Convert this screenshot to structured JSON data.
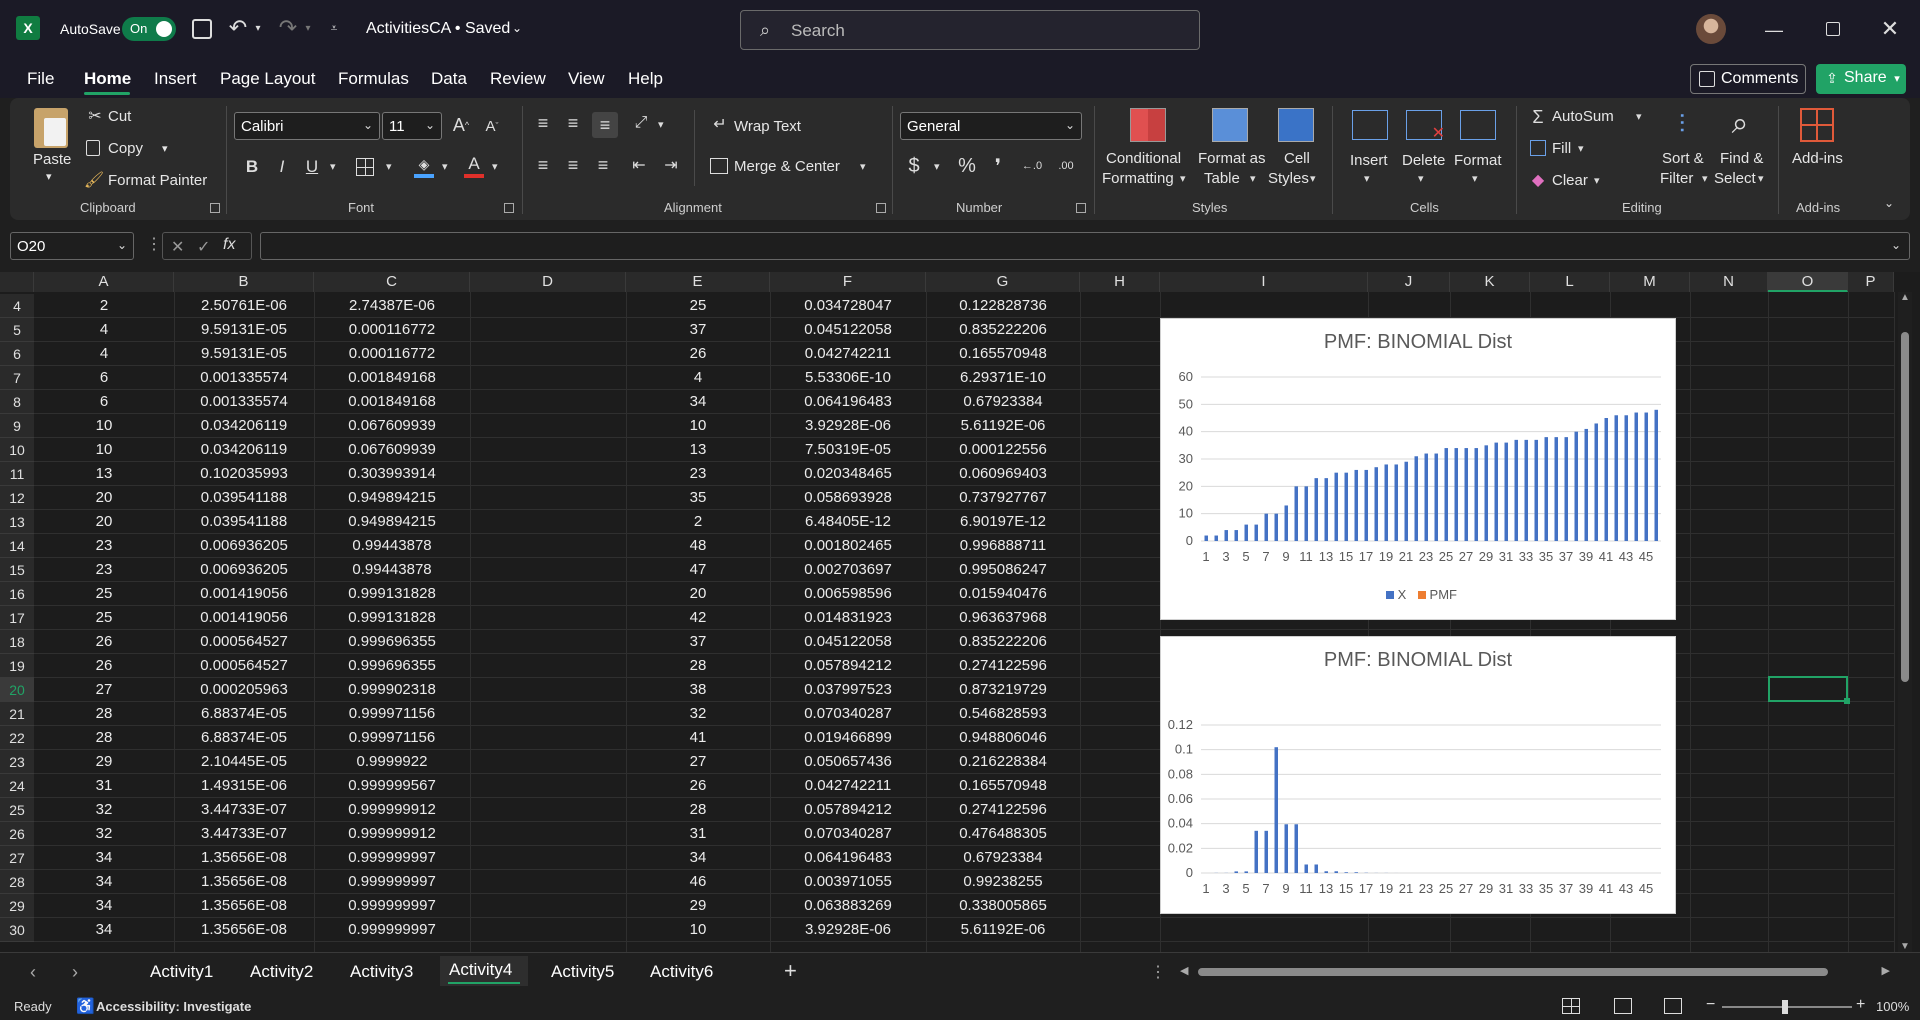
{
  "titlebar": {
    "autosave_label": "AutoSave",
    "autosave_state": "On",
    "file_title": "ActivitiesCA • Saved",
    "search_placeholder": "Search"
  },
  "menu": [
    "File",
    "Home",
    "Insert",
    "Page Layout",
    "Formulas",
    "Data",
    "Review",
    "View",
    "Help"
  ],
  "active_menu": "Home",
  "comments_label": "Comments",
  "share_label": "Share",
  "ribbon": {
    "clipboard": {
      "paste": "Paste",
      "cut": "Cut",
      "copy": "Copy",
      "format_painter": "Format Painter",
      "label": "Clipboard"
    },
    "font": {
      "name": "Calibri",
      "size": "11",
      "label": "Font"
    },
    "alignment": {
      "wrap": "Wrap Text",
      "merge": "Merge & Center",
      "label": "Alignment"
    },
    "number": {
      "format": "General",
      "label": "Number"
    },
    "styles": {
      "conditional": "Conditional",
      "conditional2": "Formatting",
      "format_table": "Format as",
      "format_table2": "Table",
      "cell_styles": "Cell",
      "cell_styles2": "Styles",
      "label": "Styles"
    },
    "cells": {
      "insert": "Insert",
      "delete": "Delete",
      "format": "Format",
      "label": "Cells"
    },
    "editing": {
      "autosum": "AutoSum",
      "fill": "Fill",
      "clear": "Clear",
      "sort": "Sort &",
      "sort2": "Filter",
      "find": "Find &",
      "find2": "Select",
      "label": "Editing"
    },
    "addins": {
      "addins": "Add-ins",
      "label": "Add-ins"
    }
  },
  "namebox": "O20",
  "columns": [
    "A",
    "B",
    "C",
    "D",
    "E",
    "F",
    "G",
    "H",
    "I",
    "J",
    "K",
    "L",
    "M",
    "N",
    "O",
    "P"
  ],
  "rows": [
    {
      "n": "4",
      "a": "2",
      "b": "2.50761E-06",
      "c": "2.74387E-06",
      "e": "25",
      "f": "0.034728047",
      "g": "0.122828736"
    },
    {
      "n": "5",
      "a": "4",
      "b": "9.59131E-05",
      "c": "0.000116772",
      "e": "37",
      "f": "0.045122058",
      "g": "0.835222206"
    },
    {
      "n": "6",
      "a": "4",
      "b": "9.59131E-05",
      "c": "0.000116772",
      "e": "26",
      "f": "0.042742211",
      "g": "0.165570948"
    },
    {
      "n": "7",
      "a": "6",
      "b": "0.001335574",
      "c": "0.001849168",
      "e": "4",
      "f": "5.53306E-10",
      "g": "6.29371E-10"
    },
    {
      "n": "8",
      "a": "6",
      "b": "0.001335574",
      "c": "0.001849168",
      "e": "34",
      "f": "0.064196483",
      "g": "0.67923384"
    },
    {
      "n": "9",
      "a": "10",
      "b": "0.034206119",
      "c": "0.067609939",
      "e": "10",
      "f": "3.92928E-06",
      "g": "5.61192E-06"
    },
    {
      "n": "10",
      "a": "10",
      "b": "0.034206119",
      "c": "0.067609939",
      "e": "13",
      "f": "7.50319E-05",
      "g": "0.000122556"
    },
    {
      "n": "11",
      "a": "13",
      "b": "0.102035993",
      "c": "0.303993914",
      "e": "23",
      "f": "0.020348465",
      "g": "0.060969403"
    },
    {
      "n": "12",
      "a": "20",
      "b": "0.039541188",
      "c": "0.949894215",
      "e": "35",
      "f": "0.058693928",
      "g": "0.737927767"
    },
    {
      "n": "13",
      "a": "20",
      "b": "0.039541188",
      "c": "0.949894215",
      "e": "2",
      "f": "6.48405E-12",
      "g": "6.90197E-12"
    },
    {
      "n": "14",
      "a": "23",
      "b": "0.006936205",
      "c": "0.99443878",
      "e": "48",
      "f": "0.001802465",
      "g": "0.996888711"
    },
    {
      "n": "15",
      "a": "23",
      "b": "0.006936205",
      "c": "0.99443878",
      "e": "47",
      "f": "0.002703697",
      "g": "0.995086247"
    },
    {
      "n": "16",
      "a": "25",
      "b": "0.001419056",
      "c": "0.999131828",
      "e": "20",
      "f": "0.006598596",
      "g": "0.015940476"
    },
    {
      "n": "17",
      "a": "25",
      "b": "0.001419056",
      "c": "0.999131828",
      "e": "42",
      "f": "0.014831923",
      "g": "0.963637968"
    },
    {
      "n": "18",
      "a": "26",
      "b": "0.000564527",
      "c": "0.999696355",
      "e": "37",
      "f": "0.045122058",
      "g": "0.835222206"
    },
    {
      "n": "19",
      "a": "26",
      "b": "0.000564527",
      "c": "0.999696355",
      "e": "28",
      "f": "0.057894212",
      "g": "0.274122596"
    },
    {
      "n": "20",
      "a": "27",
      "b": "0.000205963",
      "c": "0.999902318",
      "e": "38",
      "f": "0.037997523",
      "g": "0.873219729"
    },
    {
      "n": "21",
      "a": "28",
      "b": "6.88374E-05",
      "c": "0.999971156",
      "e": "32",
      "f": "0.070340287",
      "g": "0.546828593"
    },
    {
      "n": "22",
      "a": "28",
      "b": "6.88374E-05",
      "c": "0.999971156",
      "e": "41",
      "f": "0.019466899",
      "g": "0.948806046"
    },
    {
      "n": "23",
      "a": "29",
      "b": "2.10445E-05",
      "c": "0.9999922",
      "e": "27",
      "f": "0.050657436",
      "g": "0.216228384"
    },
    {
      "n": "24",
      "a": "31",
      "b": "1.49315E-06",
      "c": "0.999999567",
      "e": "26",
      "f": "0.042742211",
      "g": "0.165570948"
    },
    {
      "n": "25",
      "a": "32",
      "b": "3.44733E-07",
      "c": "0.999999912",
      "e": "28",
      "f": "0.057894212",
      "g": "0.274122596"
    },
    {
      "n": "26",
      "a": "32",
      "b": "3.44733E-07",
      "c": "0.999999912",
      "e": "31",
      "f": "0.070340287",
      "g": "0.476488305"
    },
    {
      "n": "27",
      "a": "34",
      "b": "1.35656E-08",
      "c": "0.999999997",
      "e": "34",
      "f": "0.064196483",
      "g": "0.67923384"
    },
    {
      "n": "28",
      "a": "34",
      "b": "1.35656E-08",
      "c": "0.999999997",
      "e": "46",
      "f": "0.003971055",
      "g": "0.99238255"
    },
    {
      "n": "29",
      "a": "34",
      "b": "1.35656E-08",
      "c": "0.999999997",
      "e": "29",
      "f": "0.063883269",
      "g": "0.338005865"
    },
    {
      "n": "30",
      "a": "34",
      "b": "1.35656E-08",
      "c": "0.999999997",
      "e": "10",
      "f": "3.92928E-06",
      "g": "5.61192E-06"
    }
  ],
  "chart_data": [
    {
      "type": "bar",
      "title": "PMF: BINOMIAL Dist",
      "legend": [
        "X",
        "PMF"
      ],
      "legend_position": "bottom",
      "colors": [
        "#4472c4",
        "#ed7d31"
      ],
      "ylim": [
        0,
        60
      ],
      "yticks": [
        0,
        10,
        20,
        30,
        40,
        50,
        60
      ],
      "xtick_labels": [
        "1",
        "3",
        "5",
        "7",
        "9",
        "11",
        "13",
        "15",
        "17",
        "19",
        "21",
        "23",
        "25",
        "27",
        "29",
        "31",
        "33",
        "35",
        "37",
        "39",
        "41",
        "43",
        "45"
      ],
      "series": [
        {
          "name": "X",
          "values": [
            2,
            2,
            4,
            4,
            6,
            6,
            10,
            10,
            13,
            20,
            20,
            23,
            23,
            25,
            25,
            26,
            26,
            27,
            28,
            28,
            29,
            31,
            32,
            32,
            34,
            34,
            34,
            34,
            35,
            36,
            36,
            37,
            37,
            37,
            38,
            38,
            38,
            40,
            41,
            43,
            45,
            46,
            46,
            47,
            47,
            48
          ]
        },
        {
          "name": "PMF",
          "values": []
        }
      ]
    },
    {
      "type": "bar",
      "title": "PMF: BINOMIAL Dist",
      "colors": [
        "#4472c4"
      ],
      "ylim": [
        0,
        0.12
      ],
      "yticks": [
        "0",
        "0.02",
        "0.04",
        "0.06",
        "0.08",
        "0.1",
        "0.12"
      ],
      "xtick_labels": [
        "1",
        "3",
        "5",
        "7",
        "9",
        "11",
        "13",
        "15",
        "17",
        "19",
        "21",
        "23",
        "25",
        "27",
        "29",
        "31",
        "33",
        "35",
        "37",
        "39",
        "41",
        "43",
        "45"
      ],
      "series": [
        {
          "values": [
            2.5e-06,
            9.59e-05,
            9.59e-05,
            0.0013,
            0.0013,
            0.0342,
            0.0342,
            0.102,
            0.0395,
            0.0395,
            0.0069,
            0.0069,
            0.0014,
            0.0014,
            0.0006,
            0.0006,
            0.0002,
            7e-05,
            7e-05,
            2e-05,
            1.5e-06,
            3e-07,
            3e-07,
            0,
            0,
            0,
            0,
            0,
            0,
            0,
            0,
            0,
            0,
            0,
            0,
            0,
            0,
            0,
            0,
            0,
            0,
            0,
            0,
            0,
            0,
            0
          ]
        }
      ]
    }
  ],
  "sheets": [
    "Activity1",
    "Activity2",
    "Activity3",
    "Activity4",
    "Activity5",
    "Activity6"
  ],
  "active_sheet": "Activity4",
  "status": {
    "ready": "Ready",
    "accessibility": "Accessibility: Investigate",
    "zoom": "100%"
  }
}
